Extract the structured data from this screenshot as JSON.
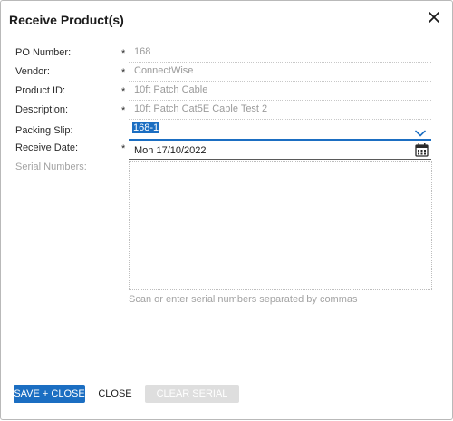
{
  "dialog": {
    "title": "Receive Product(s)"
  },
  "fields": {
    "po_number": {
      "label": "PO Number:",
      "required": "*",
      "value": "168"
    },
    "vendor": {
      "label": "Vendor:",
      "required": "*",
      "value": "ConnectWise"
    },
    "product_id": {
      "label": "Product ID:",
      "required": "*",
      "value": "10ft Patch Cable"
    },
    "description": {
      "label": "Description:",
      "required": "*",
      "value": "10ft Patch Cat5E Cable Test 2"
    },
    "packing_slip": {
      "label": "Packing Slip:",
      "value": "168-1"
    },
    "receive_date": {
      "label": "Receive Date:",
      "required": "*",
      "value": "Mon 17/10/2022"
    },
    "serial_numbers": {
      "label": "Serial Numbers:",
      "value": "",
      "hint": "Scan or enter serial numbers separated by commas"
    }
  },
  "buttons": {
    "save_close": "SAVE + CLOSE",
    "close": "CLOSE",
    "clear_serial_list": "CLEAR SERIAL LIST"
  },
  "colors": {
    "accent": "#1b6ec2",
    "muted_text": "#9a9a9a",
    "disabled_button": "#dedede"
  },
  "icons": {
    "close": "close-icon",
    "dropdown": "chevron-down-icon",
    "calendar": "calendar-icon"
  }
}
